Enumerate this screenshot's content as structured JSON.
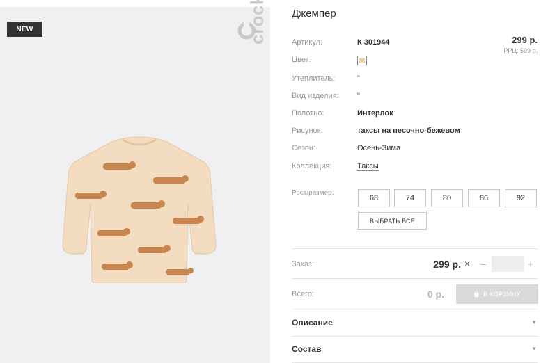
{
  "product": {
    "badge": "NEW",
    "brand": "crockid",
    "title": "Джемпер"
  },
  "properties": [
    {
      "label": "Артикул:",
      "value": "К 301944"
    },
    {
      "label": "Цвет:",
      "value": ""
    },
    {
      "label": "Утеплитель:",
      "value": "\""
    },
    {
      "label": "Вид изделия:",
      "value": "\""
    },
    {
      "label": "Полотно:",
      "value": "Интерлок"
    },
    {
      "label": "Рисунок:",
      "value": "таксы на песочно-бежевом"
    },
    {
      "label": "Сезон:",
      "value": "Осень-Зима"
    },
    {
      "label": "Коллекция:",
      "value": "Таксы"
    }
  ],
  "pricing": {
    "price": "299 р.",
    "rrp": "РРЦ: 599 р."
  },
  "sizes": {
    "label": "Рост/размер:",
    "options": [
      "68",
      "74",
      "80",
      "86",
      "92"
    ],
    "select_all": "ВЫБРАТЬ ВСЕ"
  },
  "order": {
    "label": "Заказ:",
    "price": "299 р.",
    "times": "×",
    "minus": "–",
    "plus": "+",
    "quantity": ""
  },
  "total": {
    "label": "Всего:",
    "value": "0 р.",
    "cart_button": "В КОРЗИНУ"
  },
  "accordion": [
    {
      "title": "Описание"
    },
    {
      "title": "Состав"
    }
  ],
  "colors": {
    "swatch": "#e6d4aa",
    "garment": "#f4dcc0",
    "dachshund": "#c8864e"
  }
}
